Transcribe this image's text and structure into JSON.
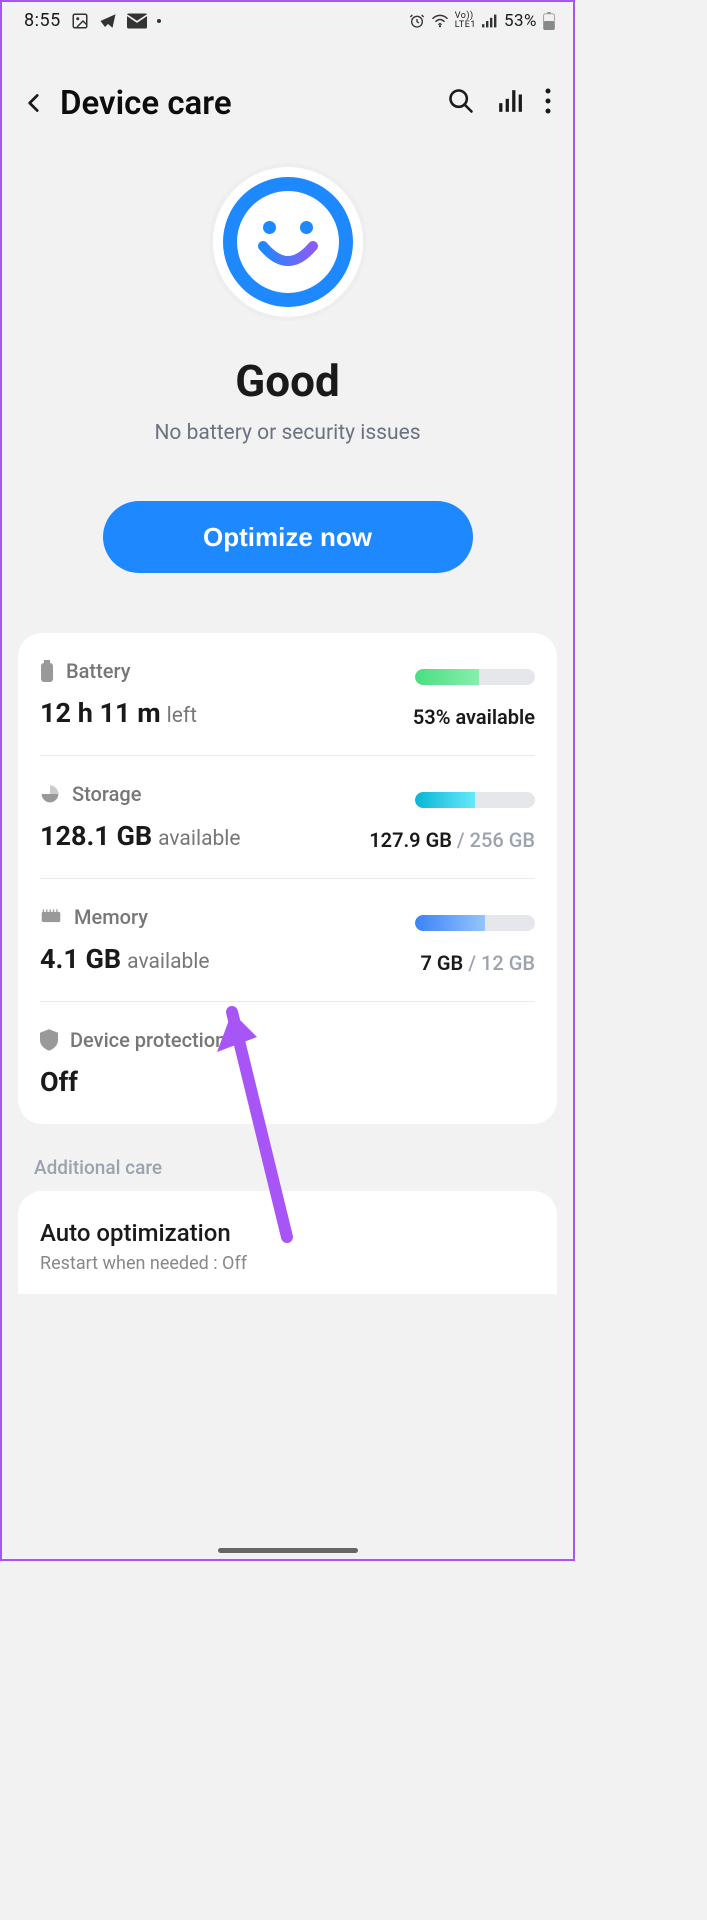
{
  "status_bar": {
    "time": "8:55",
    "battery_pct": "53%"
  },
  "header": {
    "title": "Device care"
  },
  "hero": {
    "status": "Good",
    "sub": "No battery or security issues",
    "button": "Optimize now"
  },
  "battery": {
    "label": "Battery",
    "value": "12 h 11 m",
    "suffix": "left",
    "pct": 53,
    "stat": "53% available"
  },
  "storage": {
    "label": "Storage",
    "value": "128.1 GB",
    "suffix": "available",
    "pct": 50,
    "used": "127.9 GB",
    "total": "256 GB"
  },
  "memory": {
    "label": "Memory",
    "value": "4.1 GB",
    "suffix": "available",
    "pct": 58,
    "used": "7 GB",
    "total": "12 GB"
  },
  "protection": {
    "label": "Device protection",
    "value": "Off"
  },
  "additional": {
    "header": "Additional care",
    "auto_opt_title": "Auto optimization",
    "auto_opt_sub": "Restart when needed : Off"
  }
}
